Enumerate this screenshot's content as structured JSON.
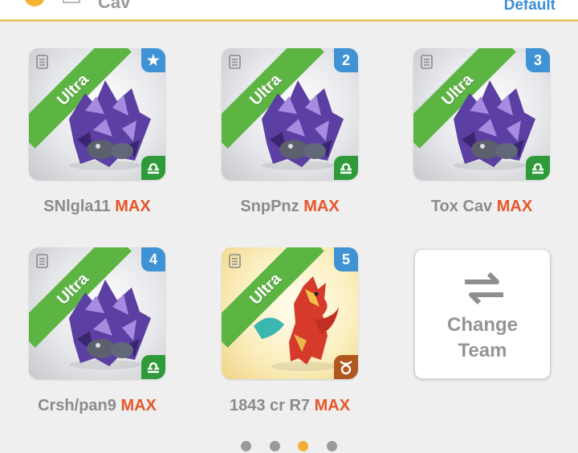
{
  "header": {
    "title": "Cav",
    "default_label": "Default"
  },
  "dragons": [
    {
      "rarity": "Ultra",
      "slot": "★",
      "name": "SNlgla11",
      "level": "MAX",
      "type": "purple",
      "sign": "libra"
    },
    {
      "rarity": "Ultra",
      "slot": "2",
      "name": "SnpPnz",
      "level": "MAX",
      "type": "purple",
      "sign": "libra"
    },
    {
      "rarity": "Ultra",
      "slot": "3",
      "name": "Tox Cav",
      "level": "MAX",
      "type": "purple",
      "sign": "libra"
    },
    {
      "rarity": "Ultra",
      "slot": "4",
      "name": "Crsh/pan9",
      "level": "MAX",
      "type": "purple",
      "sign": "libra"
    },
    {
      "rarity": "Ultra",
      "slot": "5",
      "name": "1843 cr R7",
      "level": "MAX",
      "type": "gold",
      "sign": "taurus"
    }
  ],
  "change_team": {
    "line1": "Change",
    "line2": "Team"
  },
  "pagination": {
    "pages": 4,
    "active": 3
  },
  "colors": {
    "ribbon": "#5cb443",
    "badge": "#3f93d5",
    "max": "#e8552a",
    "active_dot": "#f2ae35"
  }
}
